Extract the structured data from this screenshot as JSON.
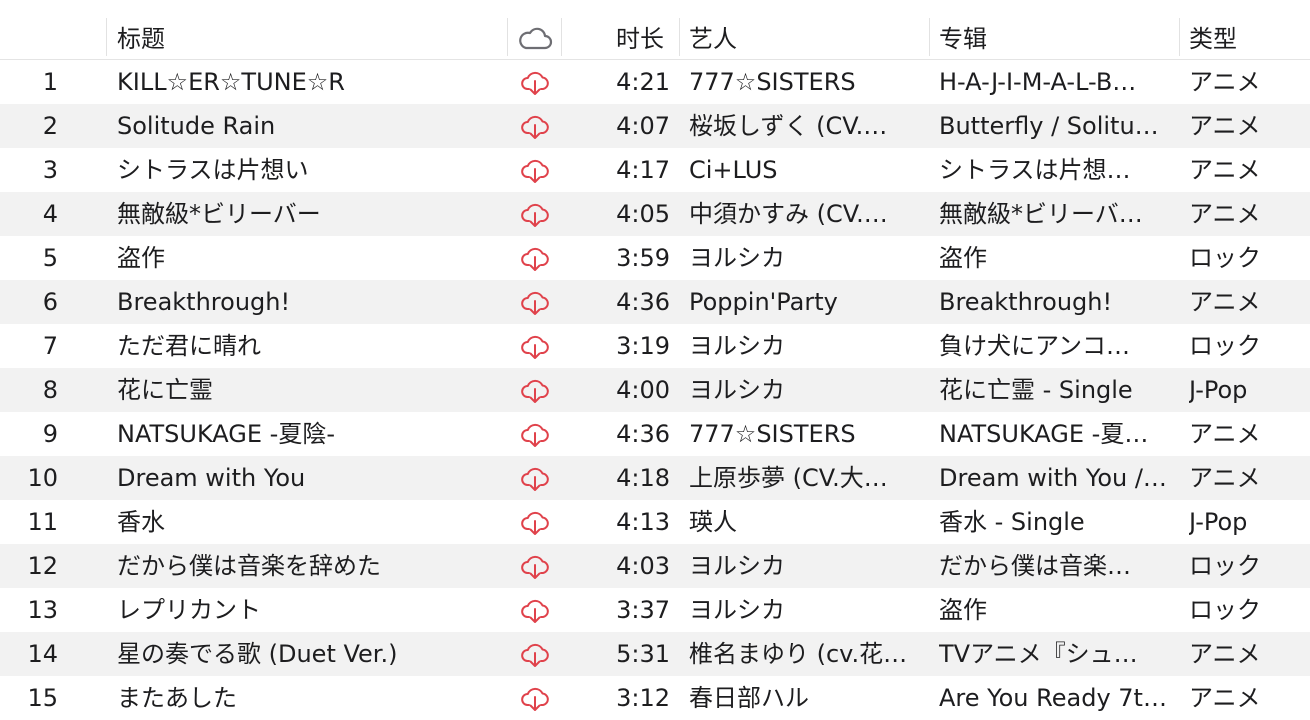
{
  "columns": {
    "title": "标题",
    "duration": "时长",
    "artist": "艺人",
    "album": "专辑",
    "genre": "类型",
    "cloud_icon": "cloud-icon"
  },
  "colors": {
    "download_icon": "#e0424b",
    "row_alt": "#f2f2f2",
    "text": "#1d1d1f"
  },
  "rows": [
    {
      "num": "1",
      "title": "KILL☆ER☆TUNE☆R",
      "duration": "4:21",
      "artist": "777☆SISTERS",
      "album": "H-A-J-I-M-A-L-B…",
      "genre": "アニメ"
    },
    {
      "num": "2",
      "title": "Solitude Rain",
      "duration": "4:07",
      "artist": "桜坂しずく (CV.…",
      "album": "Butterfly / Solitu…",
      "genre": "アニメ"
    },
    {
      "num": "3",
      "title": "シトラスは片想い",
      "duration": "4:17",
      "artist": "Ci+LUS",
      "album": "シトラスは片想…",
      "genre": "アニメ"
    },
    {
      "num": "4",
      "title": "無敵級*ビリーバー",
      "duration": "4:05",
      "artist": "中須かすみ (CV.…",
      "album": "無敵級*ビリーバ…",
      "genre": "アニメ"
    },
    {
      "num": "5",
      "title": "盗作",
      "duration": "3:59",
      "artist": "ヨルシカ",
      "album": "盗作",
      "genre": "ロック"
    },
    {
      "num": "6",
      "title": "Breakthrough!",
      "duration": "4:36",
      "artist": "Poppin'Party",
      "album": "Breakthrough!",
      "genre": "アニメ"
    },
    {
      "num": "7",
      "title": "ただ君に晴れ",
      "duration": "3:19",
      "artist": "ヨルシカ",
      "album": "負け犬にアンコ…",
      "genre": "ロック"
    },
    {
      "num": "8",
      "title": "花に亡霊",
      "duration": "4:00",
      "artist": "ヨルシカ",
      "album": "花に亡霊 - Single",
      "genre": "J-Pop"
    },
    {
      "num": "9",
      "title": "NATSUKAGE -夏陰-",
      "duration": "4:36",
      "artist": "777☆SISTERS",
      "album": "NATSUKAGE -夏…",
      "genre": "アニメ"
    },
    {
      "num": "10",
      "title": "Dream with You",
      "duration": "4:18",
      "artist": "上原歩夢 (CV.大…",
      "album": "Dream with You /…",
      "genre": "アニメ"
    },
    {
      "num": "11",
      "title": "香水",
      "duration": "4:13",
      "artist": "瑛人",
      "album": "香水 - Single",
      "genre": "J-Pop"
    },
    {
      "num": "12",
      "title": "だから僕は音楽を辞めた",
      "duration": "4:03",
      "artist": "ヨルシカ",
      "album": "だから僕は音楽…",
      "genre": "ロック"
    },
    {
      "num": "13",
      "title": "レプリカント",
      "duration": "3:37",
      "artist": "ヨルシカ",
      "album": "盗作",
      "genre": "ロック"
    },
    {
      "num": "14",
      "title": "星の奏でる歌 (Duet Ver.)",
      "duration": "5:31",
      "artist": "椎名まゆり (cv.花…",
      "album": "TVアニメ『シュ…",
      "genre": "アニメ"
    },
    {
      "num": "15",
      "title": "またあした",
      "duration": "3:12",
      "artist": "春日部ハル",
      "album": "Are You Ready 7t…",
      "genre": "アニメ"
    }
  ]
}
